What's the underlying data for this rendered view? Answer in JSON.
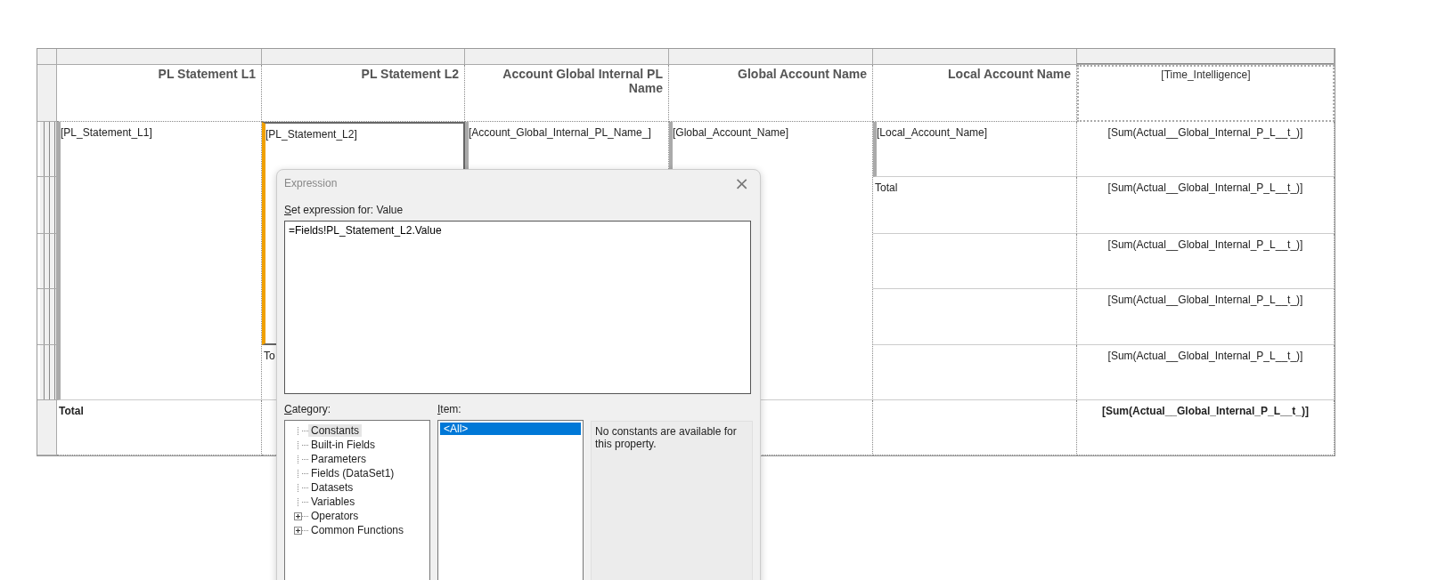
{
  "table": {
    "headers": [
      {
        "text": "PL Statement L1",
        "kind": "label"
      },
      {
        "text": "PL Statement L2",
        "kind": "label"
      },
      {
        "text": "Account Global Internal PL Name",
        "kind": "label"
      },
      {
        "text": "Global Account Name",
        "kind": "label"
      },
      {
        "text": "Local Account Name",
        "kind": "label"
      },
      {
        "text": "[Time_Intelligence]",
        "kind": "expression"
      }
    ],
    "detail_rows": [
      [
        {
          "text": "[PL_Statement_L1]",
          "kind": "group",
          "selected": false
        },
        {
          "text": "[PL_Statement_L2]",
          "kind": "group",
          "selected": true
        },
        {
          "text": "[Account_Global_Internal_PL_Name_]",
          "kind": "group",
          "selected": false
        },
        {
          "text": "[Global_Account_Name]",
          "kind": "group",
          "selected": false
        },
        {
          "text": "[Local_Account_Name]",
          "kind": "group",
          "selected": false
        },
        {
          "text": "[Sum(Actual__Global_Internal_P_L__t_)]",
          "kind": "value",
          "selected": false
        }
      ],
      [
        {
          "kind": "continued"
        },
        {
          "kind": "continued"
        },
        {
          "kind": "continued"
        },
        {
          "kind": "continued"
        },
        {
          "text": "Total",
          "kind": "total",
          "selected": false
        },
        {
          "text": "[Sum(Actual__Global_Internal_P_L__t_)]",
          "kind": "value",
          "selected": false
        }
      ],
      [
        {
          "kind": "continued"
        },
        {
          "kind": "continued"
        },
        {
          "kind": "continued"
        },
        {
          "kind": "continued"
        },
        {
          "kind": "blank"
        },
        {
          "text": "[Sum(Actual__Global_Internal_P_L__t_)]",
          "kind": "value",
          "selected": false
        }
      ],
      [
        {
          "kind": "continued"
        },
        {
          "kind": "continued"
        },
        {
          "kind": "continued"
        },
        {
          "kind": "continued"
        },
        {
          "kind": "blank"
        },
        {
          "text": "[Sum(Actual__Global_Internal_P_L__t_)]",
          "kind": "value",
          "selected": false
        }
      ],
      [
        {
          "kind": "continued"
        },
        {
          "text": "To",
          "kind": "total",
          "selected": false
        },
        {
          "kind": "continued"
        },
        {
          "kind": "continued"
        },
        {
          "kind": "blank"
        },
        {
          "text": "[Sum(Actual__Global_Internal_P_L__t_)]",
          "kind": "value",
          "selected": false
        }
      ]
    ],
    "total_row": [
      {
        "text": "Total",
        "kind": "total"
      },
      {
        "kind": "blank"
      },
      {
        "kind": "covered"
      },
      {
        "kind": "blank"
      },
      {
        "kind": "blank"
      },
      {
        "text": "[Sum(Actual__Global_Internal_P_L__t_)]",
        "kind": "value"
      }
    ]
  },
  "dialog": {
    "title": "Expression",
    "close": "×",
    "prompt": "Set expression for: Value",
    "expression": "=Fields!PL_Statement_L2.Value",
    "category_label": "Category:",
    "categories": [
      {
        "label": "Constants",
        "selected": true
      },
      {
        "label": "Built-in Fields",
        "selected": false
      },
      {
        "label": "Parameters",
        "selected": false
      },
      {
        "label": "Fields (DataSet1)",
        "selected": false
      },
      {
        "label": "Datasets",
        "selected": false
      },
      {
        "label": "Variables",
        "selected": false
      },
      {
        "label": "Operators",
        "selected": false,
        "expanded": false
      },
      {
        "label": "Common Functions",
        "selected": false,
        "expanded": false
      }
    ],
    "item_label": "Item:",
    "items": [
      {
        "label": "<All>",
        "selected": true
      }
    ],
    "description": "No constants are available for this property."
  }
}
